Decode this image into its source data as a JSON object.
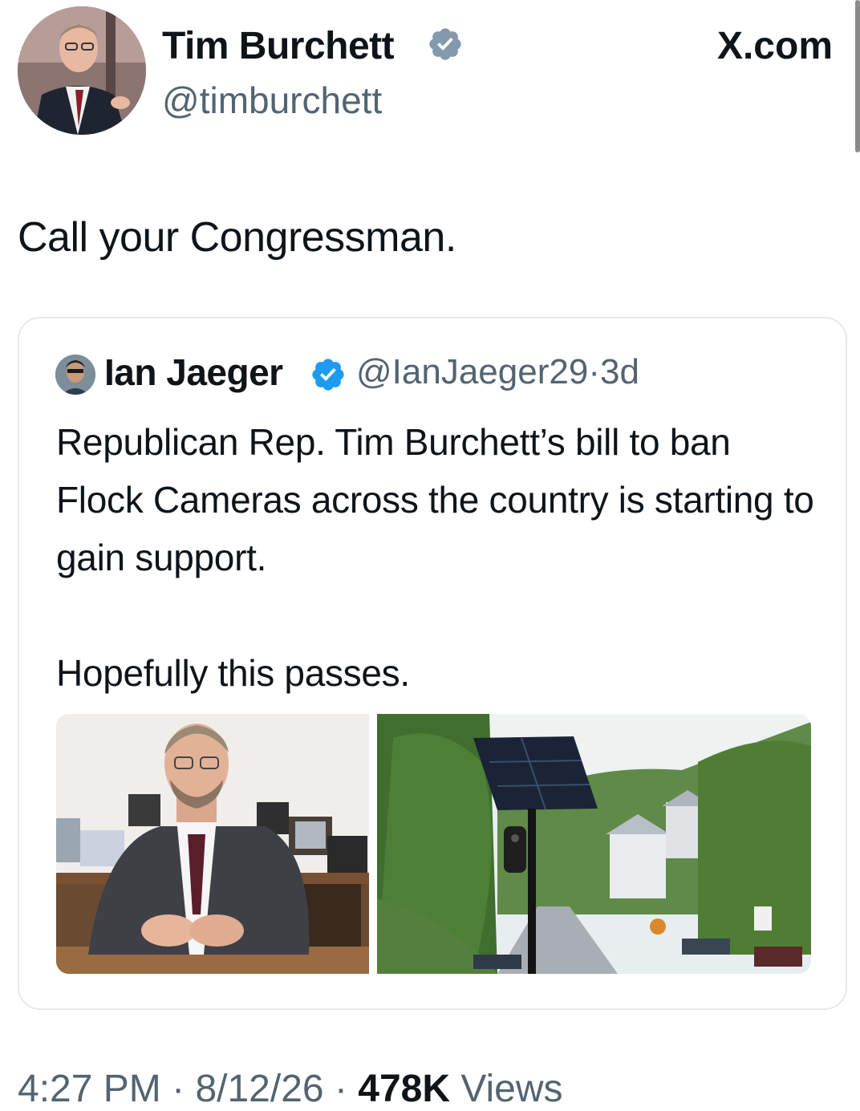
{
  "author": {
    "name": "Tim Burchett",
    "handle": "@timburchett"
  },
  "site_label": "X.com",
  "tweet": {
    "text": "Call your Congressman."
  },
  "quoted": {
    "name": "Ian Jaeger",
    "handle": "@IanJaeger29",
    "separator": "·",
    "age": "3d",
    "body_lines": [
      "Republican Rep. Tim Burchett’s bill to ban Flock Cameras across the country is starting to gain support.",
      "Hopefully this passes."
    ]
  },
  "meta": {
    "time": "4:27 PM",
    "date": "8/12/26",
    "separator": "·",
    "views_count": "478K",
    "views_label": "Views"
  },
  "colors": {
    "text": "#0f1419",
    "secondary": "#536471",
    "verified_blue": "#1d9bf0",
    "verified_gray": "#829aab",
    "border": "#e6e9ec"
  },
  "icons": {
    "author_verified": "verified-badge-icon",
    "quoted_verified": "verified-badge-icon"
  }
}
